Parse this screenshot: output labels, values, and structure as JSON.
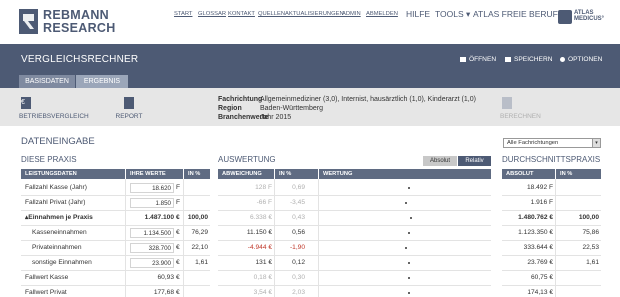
{
  "brand": {
    "line1": "REBMANN",
    "line2": "RESEARCH"
  },
  "nav": [
    "START",
    "GLOSSAR",
    "KONTAKT",
    "QUELLEN",
    "AKTUALISIERUNGEN",
    "ADMIN",
    "ABMELDEN"
  ],
  "nav_big": [
    "HILFE",
    "TOOLS ▾",
    "ATLAS FREIE BERUFE ▾"
  ],
  "atlas": {
    "line1": "ATLAS",
    "line2": "MEDICUS°"
  },
  "page_title": "VERGLEICHSRECHNER",
  "actions": {
    "open": "ÖFFNEN",
    "save": "SPEICHERN",
    "options": "OPTIONEN"
  },
  "tabs": {
    "base": "BASISDATEN",
    "result": "ERGEBNIS"
  },
  "toolbar": {
    "betriebsvergleich": "BETRIEBSVERGLEICH",
    "report": "REPORT",
    "berechnen": "BERECHNEN"
  },
  "info": {
    "fachrichtung_label": "Fachrichtung",
    "fachrichtung_value": "Allgemeinmediziner (3,0), Internist, hausärztlich (1,0), Kinderarzt (1,0)",
    "region_label": "Region",
    "region_value": "Baden-Württemberg",
    "branchenwerte_label": "Branchenwerte",
    "branchenwerte_value": "Jahr 2015"
  },
  "section_title": "DATENEINGABE",
  "filter_select": "Alle Fachrichtungen",
  "diese_praxis": {
    "title": "DIESE PRAXIS",
    "headers": [
      "LEISTUNGSDATEN",
      "IHRE WERTE",
      "IN %"
    ],
    "rows": [
      {
        "label": "Fallzahl Kasse (Jahr)",
        "value": "18.620",
        "unit": "F",
        "pct": ""
      },
      {
        "label": "Fallzahl Privat (Jahr)",
        "value": "1.850",
        "unit": "F",
        "pct": ""
      },
      {
        "label": "▴Einnahmen je Praxis",
        "value": "1.487.100",
        "unit": "€",
        "pct": "100,00"
      },
      {
        "label": "Kasseneinnahmen",
        "value": "1.134.500",
        "unit": "€",
        "pct": "76,29"
      },
      {
        "label": "Privateinnahmen",
        "value": "328.700",
        "unit": "€",
        "pct": "22,10"
      },
      {
        "label": "sonstige Einnahmen",
        "value": "23.900",
        "unit": "€",
        "pct": "1,61"
      },
      {
        "label": "Fallwert Kasse",
        "value": "60,93",
        "unit": "€",
        "pct": ""
      },
      {
        "label": "Fallwert Privat",
        "value": "177,68",
        "unit": "€",
        "pct": ""
      }
    ]
  },
  "auswertung": {
    "title": "AUSWERTUNG",
    "toggle_abs": "Absolut",
    "toggle_rel": "Relativ",
    "headers": [
      "ABWEICHUNG",
      "IN %",
      "WERTUNG"
    ],
    "rows": [
      {
        "dev": "128 F",
        "pct": "0,69"
      },
      {
        "dev": "-66 F",
        "pct": "-3,45"
      },
      {
        "dev": "6.338 €",
        "pct": "0,43"
      },
      {
        "dev": "11.150 €",
        "pct": "0,56"
      },
      {
        "dev": "-4.944 €",
        "pct": "-1,90"
      },
      {
        "dev": "131 €",
        "pct": "0,12"
      },
      {
        "dev": "0,18 €",
        "pct": "0,30"
      },
      {
        "dev": "3,54 €",
        "pct": "2,03"
      }
    ]
  },
  "durchschnitt": {
    "title": "DURCHSCHNITTSPRAXIS",
    "headers": [
      "ABSOLUT",
      "IN %"
    ],
    "rows": [
      {
        "value": "18.492 F",
        "pct": ""
      },
      {
        "value": "1.916 F",
        "pct": ""
      },
      {
        "value": "1.480.762 €",
        "pct": "100,00"
      },
      {
        "value": "1.123.350 €",
        "pct": "75,86"
      },
      {
        "value": "333.644 €",
        "pct": "22,53"
      },
      {
        "value": "23.769 €",
        "pct": "1,61"
      },
      {
        "value": "60,75 €",
        "pct": ""
      },
      {
        "value": "174,13 €",
        "pct": ""
      }
    ]
  }
}
